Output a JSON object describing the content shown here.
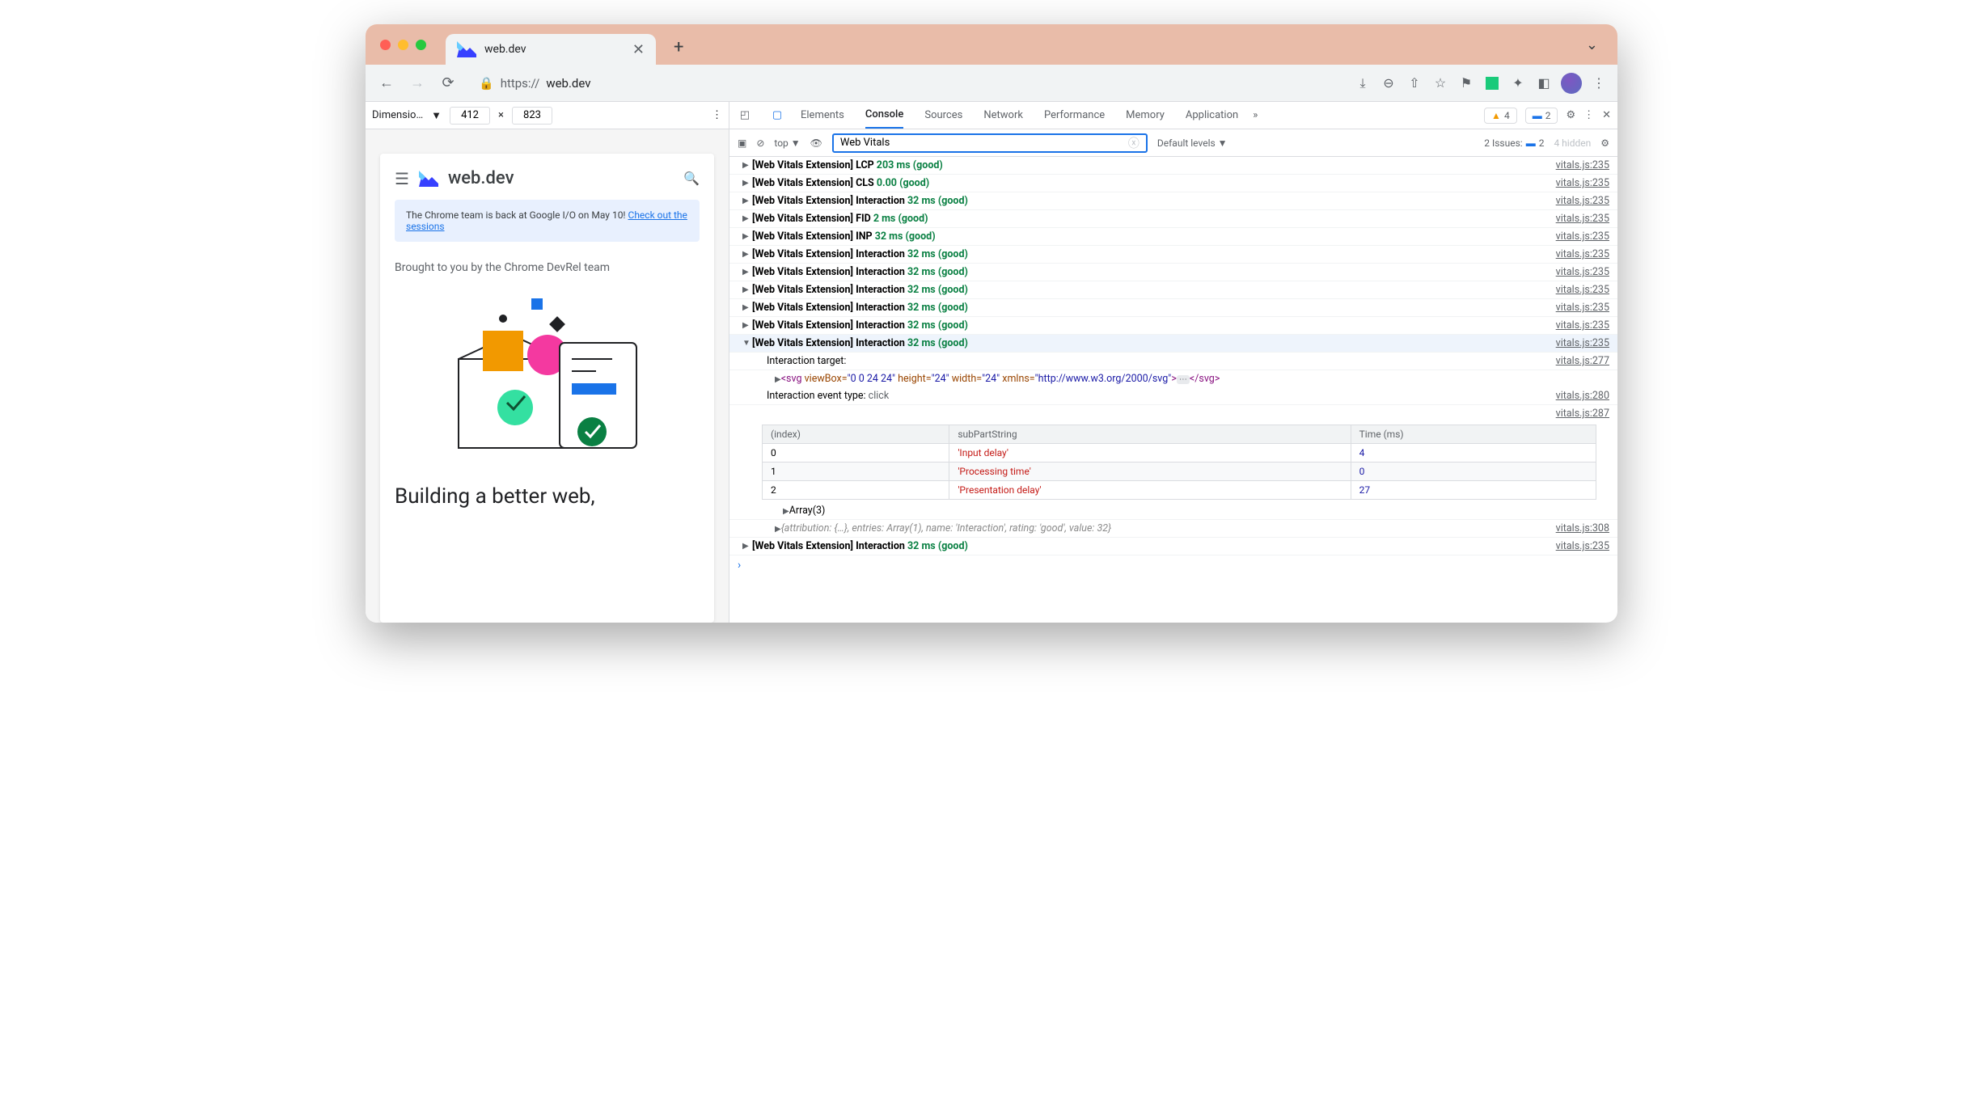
{
  "browser": {
    "tab_title": "web.dev",
    "url_prefix": "https://",
    "url_domain": "web.dev",
    "newtab_plus": "+",
    "chevron": "⌄"
  },
  "device_toolbar": {
    "label": "Dimensio…",
    "width": "412",
    "times": "×",
    "height": "823",
    "more": "⋮"
  },
  "page": {
    "menu": "☰",
    "brand": "web.dev",
    "banner_pre": "The Chrome team is back at Google I/O on May 10! ",
    "banner_link": "Check out the sessions",
    "devrel": "Brought to you by the Chrome DevRel team",
    "heading": "Building a better web,"
  },
  "devtools": {
    "tabs": [
      "Elements",
      "Console",
      "Sources",
      "Network",
      "Performance",
      "Memory",
      "Application"
    ],
    "active_tab": "Console",
    "warn_count": "4",
    "msg_count": "2",
    "issues_label": "2 Issues:",
    "issues_count": "2",
    "hidden_label": "4 hidden",
    "filter": {
      "context": "top",
      "value": "Web Vitals",
      "levels": "Default levels"
    },
    "logs": [
      {
        "prefix": "[Web Vitals Extension]",
        "metric": "LCP",
        "value": "203 ms (good)",
        "src": "vitals.js:235"
      },
      {
        "prefix": "[Web Vitals Extension]",
        "metric": "CLS",
        "value": "0.00 (good)",
        "src": "vitals.js:235"
      },
      {
        "prefix": "[Web Vitals Extension]",
        "metric": "Interaction",
        "value": "32 ms (good)",
        "src": "vitals.js:235"
      },
      {
        "prefix": "[Web Vitals Extension]",
        "metric": "FID",
        "value": "2 ms (good)",
        "src": "vitals.js:235"
      },
      {
        "prefix": "[Web Vitals Extension]",
        "metric": "INP",
        "value": "32 ms (good)",
        "src": "vitals.js:235"
      },
      {
        "prefix": "[Web Vitals Extension]",
        "metric": "Interaction",
        "value": "32 ms (good)",
        "src": "vitals.js:235"
      },
      {
        "prefix": "[Web Vitals Extension]",
        "metric": "Interaction",
        "value": "32 ms (good)",
        "src": "vitals.js:235"
      },
      {
        "prefix": "[Web Vitals Extension]",
        "metric": "Interaction",
        "value": "32 ms (good)",
        "src": "vitals.js:235"
      },
      {
        "prefix": "[Web Vitals Extension]",
        "metric": "Interaction",
        "value": "32 ms (good)",
        "src": "vitals.js:235"
      },
      {
        "prefix": "[Web Vitals Extension]",
        "metric": "Interaction",
        "value": "32 ms (good)",
        "src": "vitals.js:235"
      }
    ],
    "expanded": {
      "prefix": "[Web Vitals Extension]",
      "metric": "Interaction",
      "value": "32 ms (good)",
      "src": "vitals.js:235",
      "target_label": "Interaction target:",
      "target_src": "vitals.js:277",
      "svg_view": "\"0 0 24 24\"",
      "svg_h": "\"24\"",
      "svg_w": "\"24\"",
      "svg_ns": "\"http://www.w3.org/2000/svg\"",
      "event_label": "Interaction event type:",
      "event_val": "click",
      "event_src": "vitals.js:280",
      "table_src": "vitals.js:287",
      "table": {
        "cols": [
          "(index)",
          "subPartString",
          "Time (ms)"
        ],
        "rows": [
          {
            "i": "0",
            "s": "'Input delay'",
            "t": "4"
          },
          {
            "i": "1",
            "s": "'Processing time'",
            "t": "0"
          },
          {
            "i": "2",
            "s": "'Presentation delay'",
            "t": "27"
          }
        ]
      },
      "array_label": "Array(3)",
      "attribution": "{attribution: {…}, entries: Array(1), name: 'Interaction', rating: 'good', value: 32}",
      "attribution_src": "vitals.js:308"
    },
    "trailing": {
      "prefix": "[Web Vitals Extension]",
      "metric": "Interaction",
      "value": "32 ms (good)",
      "src": "vitals.js:235"
    }
  }
}
